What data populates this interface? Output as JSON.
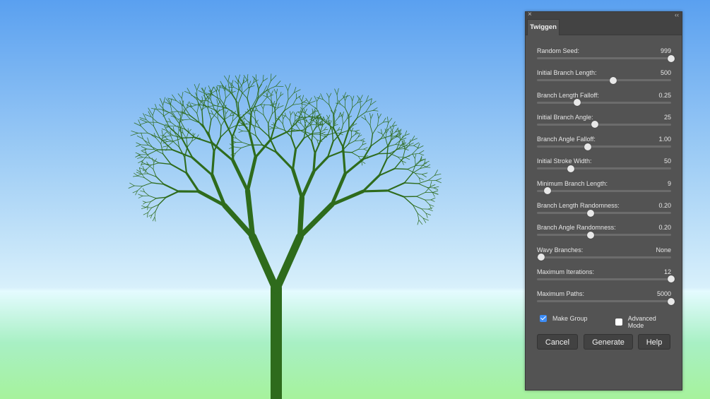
{
  "panel": {
    "tab_label": "Twiggen",
    "close_glyph": "×",
    "collapse_glyph": "‹‹",
    "sliders": [
      {
        "label": "Random Seed:",
        "value": "999",
        "position": 1.0
      },
      {
        "label": "Initial Branch Length:",
        "value": "500",
        "position": 0.57
      },
      {
        "label": "Branch Length Falloff:",
        "value": "0.25",
        "position": 0.3
      },
      {
        "label": "Initial Branch Angle:",
        "value": "25",
        "position": 0.43
      },
      {
        "label": "Branch Angle Falloff:",
        "value": "1.00",
        "position": 0.38
      },
      {
        "label": "Initial Stroke Width:",
        "value": "50",
        "position": 0.25
      },
      {
        "label": "Minimum Branch Length:",
        "value": "9",
        "position": 0.08
      },
      {
        "label": "Branch Length Randomness:",
        "value": "0.20",
        "position": 0.4
      },
      {
        "label": "Branch Angle Randomness:",
        "value": "0.20",
        "position": 0.4
      },
      {
        "label": "Wavy Branches:",
        "value": "None",
        "position": 0.03
      },
      {
        "label": "Maximum Iterations:",
        "value": "12",
        "position": 1.0
      },
      {
        "label": "Maximum Paths:",
        "value": "5000",
        "position": 1.0
      }
    ],
    "make_group": {
      "label": "Make Group",
      "checked": true
    },
    "advanced_mode": {
      "label": "Advanced Mode",
      "checked": false
    },
    "buttons": {
      "cancel": "Cancel",
      "generate": "Generate",
      "help": "Help"
    }
  },
  "colors": {
    "tree": "#2e6b1c",
    "panel_bg": "#535353",
    "checkbox_accent": "#3d8cf5"
  }
}
